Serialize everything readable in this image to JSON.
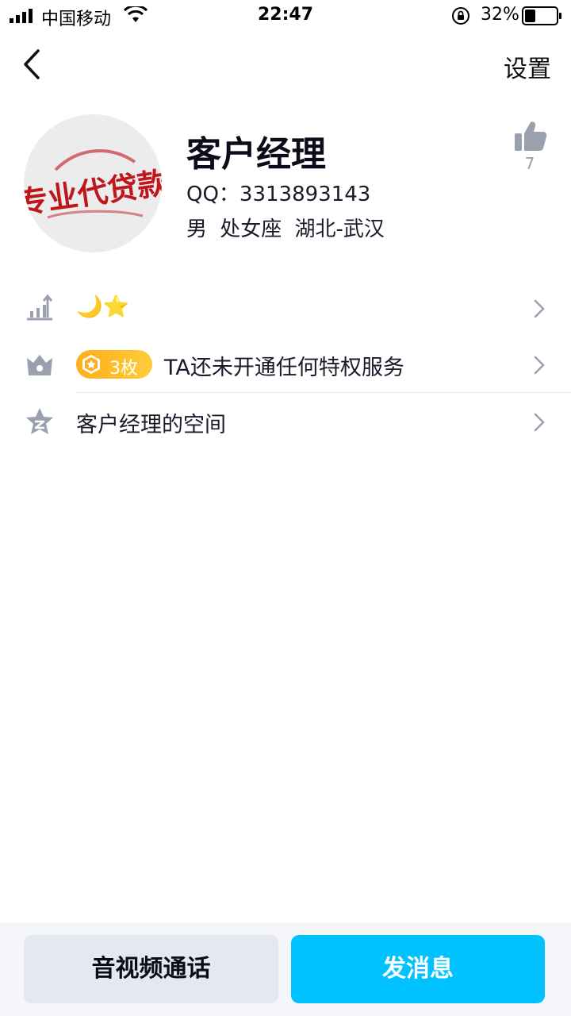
{
  "status_bar": {
    "carrier": "中国移动",
    "time": "22:47",
    "battery_percent": "32%",
    "battery_level": 0.32,
    "icons": [
      "signal-icon",
      "wifi-icon",
      "rotation-lock-icon",
      "battery-icon"
    ]
  },
  "nav": {
    "back_icon": "chevron-left-icon",
    "settings_label": "设置"
  },
  "profile": {
    "avatar_text": "专业代贷款",
    "name": "客户经理",
    "qq": "QQ：3313893143",
    "info": "男 处女座 湖北-武汉",
    "like_count": "7",
    "like_icon": "thumbs-up-icon"
  },
  "rows": [
    {
      "icon": "level-chart-icon",
      "text": "🌙⭐"
    },
    {
      "icon": "crown-icon",
      "badge": "3枚",
      "text": "TA还未开通任何特权服务"
    },
    {
      "icon": "qzone-star-icon",
      "text": "客户经理的空间"
    }
  ],
  "bottom": {
    "call_label": "音视频通话",
    "message_label": "发消息"
  },
  "colors": {
    "accent": "#00c2ff",
    "badge": "#ffae1a",
    "icon_gray": "#9aa0ad"
  }
}
